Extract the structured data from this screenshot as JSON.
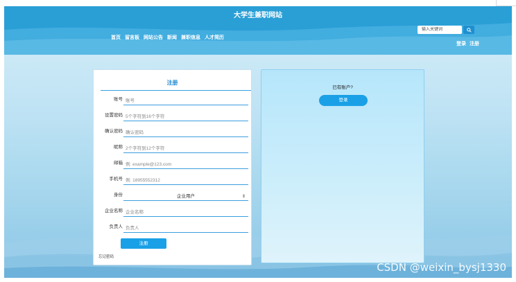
{
  "site": {
    "title": "大学生兼职网站"
  },
  "nav": {
    "items": [
      "首页",
      "留言板",
      "网站公告",
      "新闻",
      "兼职信息",
      "人才简历"
    ]
  },
  "search": {
    "placeholder": "输入关键词"
  },
  "auth": {
    "login": "登录",
    "register": "注册"
  },
  "register_form": {
    "title": "注册",
    "fields": [
      {
        "label": "账号",
        "placeholder": "账号"
      },
      {
        "label": "设置密码",
        "placeholder": "5个字符到16个字符"
      },
      {
        "label": "确认密码",
        "placeholder": "确认密码"
      },
      {
        "label": "昵称",
        "placeholder": "2个字符到12个字符"
      },
      {
        "label": "邮箱",
        "placeholder": "例: example@123.com"
      },
      {
        "label": "手机号",
        "placeholder": "例: 18955552312"
      },
      {
        "label": "身份",
        "value": "企业用户"
      },
      {
        "label": "企业名称",
        "placeholder": "企业名称"
      },
      {
        "label": "负责人",
        "placeholder": "负责人"
      }
    ],
    "submit": "注册",
    "forgot": "忘记密码"
  },
  "login_panel": {
    "prompt": "已有账户?",
    "button": "登录"
  },
  "watermark": "CSDN @weixin_bysj1330",
  "colors": {
    "header": "#2a9fd6",
    "accent": "#1aa0e6",
    "underline": "#3a9ede"
  }
}
